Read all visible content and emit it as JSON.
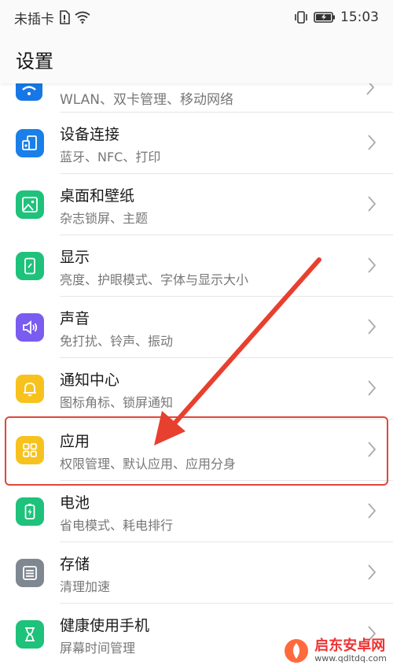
{
  "status_bar": {
    "carrier": "未插卡",
    "time": "15:03"
  },
  "header": {
    "title": "设置"
  },
  "settings": {
    "partial": {
      "subtitle": "WLAN、双卡管理、移动网络",
      "icon": "wifi-icon",
      "color": "#1677e6"
    },
    "items": [
      {
        "title": "设备连接",
        "subtitle": "蓝牙、NFC、打印",
        "icon": "device-connection-icon",
        "color": "#1a7fe8"
      },
      {
        "title": "桌面和壁纸",
        "subtitle": "杂志锁屏、主题",
        "icon": "wallpaper-icon",
        "color": "#1ec27a"
      },
      {
        "title": "显示",
        "subtitle": "亮度、护眼模式、字体与显示大小",
        "icon": "display-icon",
        "color": "#1ec27a"
      },
      {
        "title": "声音",
        "subtitle": "免打扰、铃声、振动",
        "icon": "speaker-icon",
        "color": "#7a5cf0"
      },
      {
        "title": "通知中心",
        "subtitle": "图标角标、锁屏通知",
        "icon": "bell-icon",
        "color": "#f7c21d"
      },
      {
        "title": "应用",
        "subtitle": "权限管理、默认应用、应用分身",
        "icon": "apps-grid-icon",
        "color": "#f7c21d"
      },
      {
        "title": "电池",
        "subtitle": "省电模式、耗电排行",
        "icon": "battery-icon",
        "color": "#1ec27a"
      },
      {
        "title": "存储",
        "subtitle": "清理加速",
        "icon": "storage-icon",
        "color": "#7f8790"
      },
      {
        "title": "健康使用手机",
        "subtitle": "屏幕时间管理",
        "icon": "hourglass-icon",
        "color": "#1ec27a"
      }
    ]
  },
  "watermark": {
    "title": "启东安卓网",
    "url": "www.qdltdq.com"
  }
}
